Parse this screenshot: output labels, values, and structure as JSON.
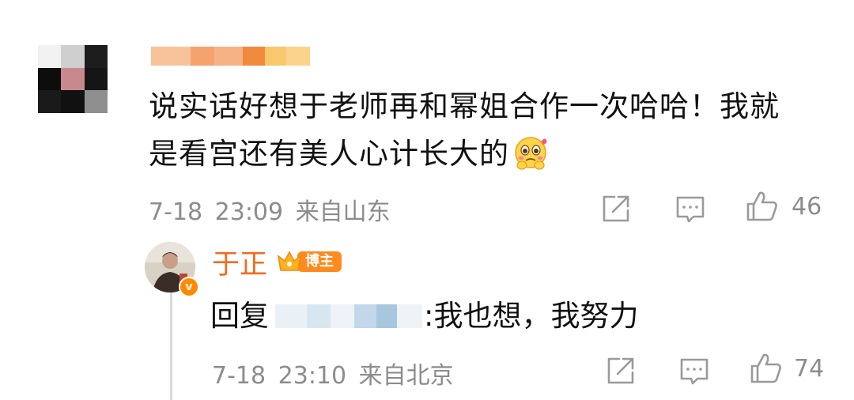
{
  "comment": {
    "text_line1": "说实话好想于老师再和幂姐合作一次哈哈！我就",
    "text_line2": "是看宫还有美人心计长大的",
    "emoji": "pleading-face-emoji",
    "date": "7-18",
    "time": "23:09",
    "location": "来自山东",
    "likes": "46"
  },
  "reply": {
    "author": "于正",
    "badge": "博主",
    "prefix": "回复",
    "text": ":我也想，我努力",
    "date": "7-18",
    "time": "23:10",
    "location": "来自北京",
    "likes": "74"
  },
  "colors": {
    "author_name": "#f06c1f",
    "meta_gray": "#8c8c8c",
    "badge_orange": "#ff8a00"
  },
  "icons": [
    "share-icon",
    "comment-icon",
    "like-icon"
  ]
}
